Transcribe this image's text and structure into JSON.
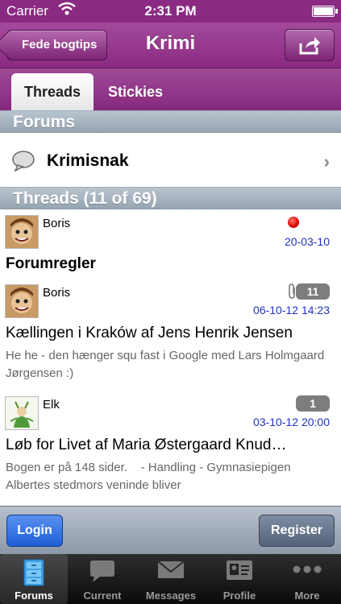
{
  "status_bar": {
    "carrier": "Carrier",
    "time": "2:31 PM"
  },
  "nav": {
    "back_label": "Fede bogtips",
    "title": "Krimi",
    "share_icon": "share-icon"
  },
  "segments": [
    {
      "label": "Threads",
      "active": true
    },
    {
      "label": "Stickies",
      "active": false
    }
  ],
  "forums_header": "Forums",
  "forum": {
    "name": "Krimisnak",
    "icon": "speech-bubble-icon"
  },
  "threads_header": "Threads (11 of 69)",
  "threads": [
    {
      "author": "Boris",
      "date": "20-03-10",
      "title": "Forumregler",
      "unread": true,
      "reply_count": "",
      "excerpt": ""
    },
    {
      "author": "Boris",
      "date": "06-10-12 14:23",
      "title": "Kællingen i Kraków af Jens Henrik Jensen",
      "reply_count": "11",
      "attachment": true,
      "excerpt": "He he - den hænger squ fast i Google med Lars Holmgaard Jørgensen :)"
    },
    {
      "author": "Elk",
      "date": "03-10-12 20:00",
      "title": "Løb for Livet af Maria Østergaard Knud…",
      "reply_count": "1",
      "excerpt": "Bogen er på 148 sider.    - Handling - Gymnasiepigen Albertes stedmors veninde bliver"
    }
  ],
  "toolbar": {
    "login_label": "Login",
    "register_label": "Register"
  },
  "tabs": [
    {
      "label": "Forums",
      "icon": "cabinet-icon",
      "active": true
    },
    {
      "label": "Current",
      "icon": "chat-bubble-icon",
      "active": false
    },
    {
      "label": "Messages",
      "icon": "envelope-icon",
      "active": false
    },
    {
      "label": "Profile",
      "icon": "id-card-icon",
      "active": false
    },
    {
      "label": "More",
      "icon": "more-dots-icon",
      "active": false
    }
  ],
  "colors": {
    "nav_purple": "#8a2a82",
    "link_blue": "#1f33b8",
    "login_blue": "#1f5ed8"
  }
}
